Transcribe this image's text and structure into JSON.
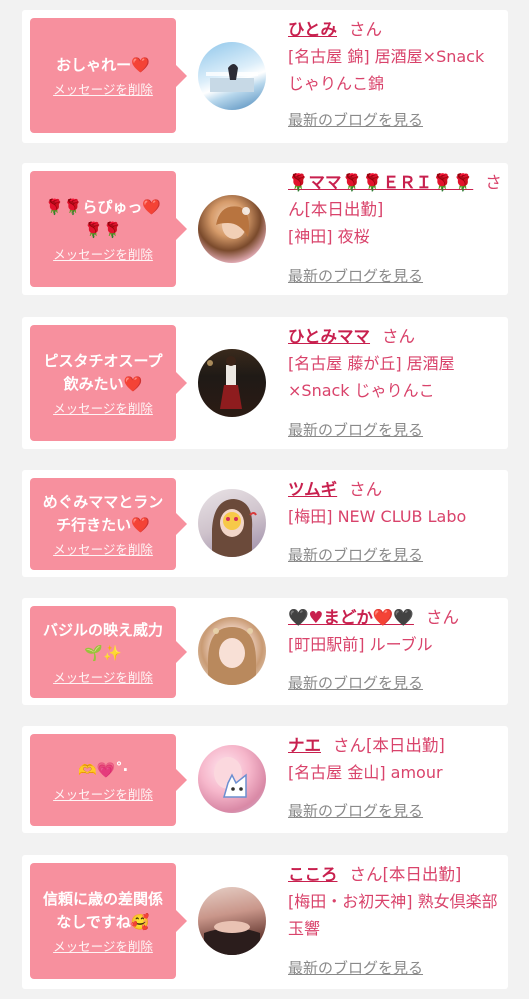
{
  "items": [
    {
      "message": "おしゃれー❤️",
      "delete_label": "メッセージを削除",
      "name": "ひとみ",
      "san": "さん",
      "status": "",
      "shop": "[名古屋 錦] 居酒屋×Snack じゃりんこ錦",
      "blog_link": "最新のブログを見る",
      "avatar": "photo-avatar"
    },
    {
      "message": "🌹🌹らぴゅっ❤️🌹🌹",
      "delete_label": "メッセージを削除",
      "name": "🌹ママ🌹🌹ＥＲＩ🌹🌹",
      "san": "さん",
      "status": "[本日出勤]",
      "shop": "[神田] 夜桜",
      "blog_link": "最新のブログを見る",
      "avatar": "photo-avatar"
    },
    {
      "message": "ピスタチオスープ飲みたい❤️",
      "delete_label": "メッセージを削除",
      "name": "ひとみママ",
      "san": "さん",
      "status": "",
      "shop": "[名古屋 藤が丘] 居酒屋×Snack じゃりんこ",
      "blog_link": "最新のブログを見る",
      "avatar": "photo-avatar"
    },
    {
      "message": "めぐみママとランチ行きたい❤️",
      "delete_label": "メッセージを削除",
      "name": "ツムギ",
      "san": "さん",
      "status": "",
      "shop": "[梅田] NEW CLUB Labo",
      "blog_link": "最新のブログを見る",
      "avatar": "photo-avatar"
    },
    {
      "message": "バジルの映え威力🌱✨",
      "delete_label": "メッセージを削除",
      "name": "🖤♥まどか❤️🖤",
      "san": "さん",
      "status": "",
      "shop": "[町田駅前] ルーブル",
      "blog_link": "最新のブログを見る",
      "avatar": "photo-avatar"
    },
    {
      "message": "🫶💗˚‧",
      "delete_label": "メッセージを削除",
      "name": "ナエ",
      "san": "さん",
      "status": "[本日出勤]",
      "shop": "[名古屋 金山] amour",
      "blog_link": "最新のブログを見る",
      "avatar": "photo-avatar"
    },
    {
      "message": "信頼に歳の差関係なしですね🥰",
      "delete_label": "メッセージを削除",
      "name": "こころ",
      "san": "さん",
      "status": "[本日出勤]",
      "shop": "[梅田・お初天神] 熟女倶楽部 玉響",
      "blog_link": "最新のブログを見る",
      "avatar": "photo-avatar"
    }
  ],
  "colors": {
    "bubble": "#f7909e",
    "name": "#c8204e",
    "text": "#d9436b",
    "link": "#8a8a8a",
    "background": "#f2f2f2"
  }
}
